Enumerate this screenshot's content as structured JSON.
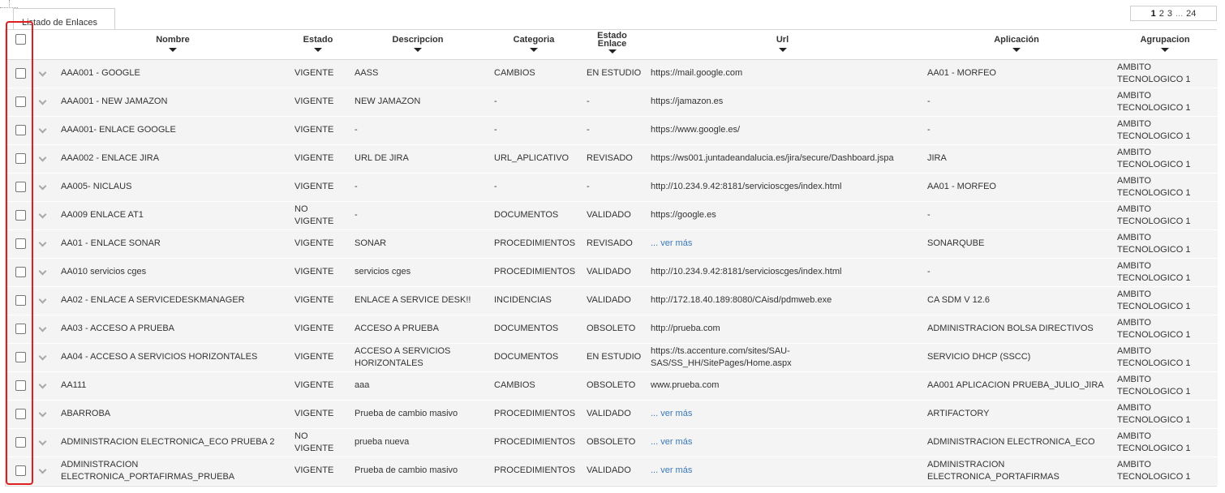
{
  "tab": {
    "label": "Listado de Enlaces"
  },
  "pagination": {
    "current": "1",
    "pages": [
      "2",
      "3"
    ],
    "ellipsis": "...",
    "last": "24"
  },
  "columns": {
    "nombre": "Nombre",
    "estado": "Estado",
    "descripcion": "Descripcion",
    "categoria": "Categoria",
    "estado_enlace": "Estado Enlace",
    "url": "Url",
    "aplicacion": "Aplicación",
    "agrupacion": "Agrupacion"
  },
  "rows": [
    {
      "nombre": "AAA001 - GOOGLE",
      "estado": "VIGENTE",
      "descripcion": "AASS",
      "categoria": "CAMBIOS",
      "estado_enlace": "EN ESTUDIO",
      "url": "https://mail.google.com",
      "aplicacion": "AA01 - MORFEO",
      "agrupacion": "AMBITO TECNOLOGICO 1"
    },
    {
      "nombre": "AAA001 - NEW JAMAZON",
      "estado": "VIGENTE",
      "descripcion": "NEW JAMAZON",
      "categoria": "-",
      "estado_enlace": "-",
      "url": "https://jamazon.es",
      "aplicacion": "-",
      "agrupacion": "AMBITO TECNOLOGICO 1"
    },
    {
      "nombre": "AAA001- ENLACE GOOGLE",
      "estado": "VIGENTE",
      "descripcion": "-",
      "categoria": "-",
      "estado_enlace": "-",
      "url": "https://www.google.es/",
      "aplicacion": "-",
      "agrupacion": "AMBITO TECNOLOGICO 1"
    },
    {
      "nombre": "AAA002 - ENLACE JIRA",
      "estado": "VIGENTE",
      "descripcion": "URL DE JIRA",
      "categoria": "URL_APLICATIVO",
      "estado_enlace": "REVISADO",
      "url": "https://ws001.juntadeandalucia.es/jira/secure/Dashboard.jspa",
      "aplicacion": "JIRA",
      "agrupacion": "AMBITO TECNOLOGICO 1"
    },
    {
      "nombre": "AA005- NICLAUS",
      "estado": "VIGENTE",
      "descripcion": "-",
      "categoria": "-",
      "estado_enlace": "-",
      "url": "http://10.234.9.42:8181/servicioscges/index.html",
      "aplicacion": "AA01 - MORFEO",
      "agrupacion": "AMBITO TECNOLOGICO 1"
    },
    {
      "nombre": "AA009 ENLACE AT1",
      "estado": "NO VIGENTE",
      "descripcion": "-",
      "categoria": "DOCUMENTOS",
      "estado_enlace": "VALIDADO",
      "url": "https://google.es",
      "aplicacion": "-",
      "agrupacion": "AMBITO TECNOLOGICO 1"
    },
    {
      "nombre": "AA01 - ENLACE SONAR",
      "estado": "VIGENTE",
      "descripcion": "SONAR",
      "categoria": "PROCEDIMIENTOS",
      "estado_enlace": "REVISADO",
      "url": "... ver más",
      "url_is_link": true,
      "aplicacion": "SONARQUBE",
      "agrupacion": "AMBITO TECNOLOGICO 1"
    },
    {
      "nombre": "AA010 servicios cges",
      "estado": "VIGENTE",
      "descripcion": "servicios cges",
      "categoria": "PROCEDIMIENTOS",
      "estado_enlace": "VALIDADO",
      "url": "http://10.234.9.42:8181/servicioscges/index.html",
      "aplicacion": "-",
      "agrupacion": "AMBITO TECNOLOGICO 1"
    },
    {
      "nombre": "AA02 - ENLACE A SERVICEDESKMANAGER",
      "estado": "VIGENTE",
      "descripcion": "ENLACE A SERVICE DESK!!",
      "categoria": "INCIDENCIAS",
      "estado_enlace": "VALIDADO",
      "url": "http://172.18.40.189:8080/CAisd/pdmweb.exe",
      "aplicacion": "CA SDM V 12.6",
      "agrupacion": "AMBITO TECNOLOGICO 1"
    },
    {
      "nombre": "AA03 - ACCESO A PRUEBA",
      "estado": "VIGENTE",
      "descripcion": "ACCESO A PRUEBA",
      "categoria": "DOCUMENTOS",
      "estado_enlace": "OBSOLETO",
      "url": "http://prueba.com",
      "aplicacion": "ADMINISTRACION BOLSA DIRECTIVOS",
      "agrupacion": "AMBITO TECNOLOGICO 1"
    },
    {
      "nombre": "AA04 - ACCESO A SERVICIOS HORIZONTALES",
      "estado": "VIGENTE",
      "descripcion": "ACCESO A SERVICIOS HORIZONTALES",
      "categoria": "DOCUMENTOS",
      "estado_enlace": "EN ESTUDIO",
      "url": "https://ts.accenture.com/sites/SAU-SAS/SS_HH/SitePages/Home.aspx",
      "aplicacion": "SERVICIO DHCP (SSCC)",
      "agrupacion": "AMBITO TECNOLOGICO 1"
    },
    {
      "nombre": "AA111",
      "estado": "VIGENTE",
      "descripcion": "aaa",
      "categoria": "CAMBIOS",
      "estado_enlace": "OBSOLETO",
      "url": "www.prueba.com",
      "aplicacion": "AA001 APLICACION PRUEBA_JULIO_JIRA",
      "agrupacion": "AMBITO TECNOLOGICO 1"
    },
    {
      "nombre": "ABARROBA",
      "estado": "VIGENTE",
      "descripcion": "Prueba de cambio masivo",
      "categoria": "PROCEDIMIENTOS",
      "estado_enlace": "VALIDADO",
      "url": "... ver más",
      "url_is_link": true,
      "aplicacion": "ARTIFACTORY",
      "agrupacion": "AMBITO TECNOLOGICO 1"
    },
    {
      "nombre": "ADMINISTRACION ELECTRONICA_ECO PRUEBA 2",
      "estado": "NO VIGENTE",
      "descripcion": "prueba nueva",
      "categoria": "PROCEDIMIENTOS",
      "estado_enlace": "OBSOLETO",
      "url": "... ver más",
      "url_is_link": true,
      "aplicacion": "ADMINISTRACION ELECTRONICA_ECO",
      "agrupacion": "AMBITO TECNOLOGICO 1"
    },
    {
      "nombre": "ADMINISTRACION ELECTRONICA_PORTAFIRMAS_PRUEBA",
      "estado": "VIGENTE",
      "descripcion": "Prueba de cambio masivo",
      "categoria": "PROCEDIMIENTOS",
      "estado_enlace": "VALIDADO",
      "url": "... ver más",
      "url_is_link": true,
      "aplicacion": "ADMINISTRACION ELECTRONICA_PORTAFIRMAS",
      "agrupacion": "AMBITO TECNOLOGICO 1"
    }
  ],
  "icons": {
    "expand": "chevron-down-icon",
    "sort": "sort-desc-icon"
  },
  "colors": {
    "link": "#3b78b8",
    "highlight": "#dd1f1f",
    "row_bg": "#f4f4f4"
  }
}
